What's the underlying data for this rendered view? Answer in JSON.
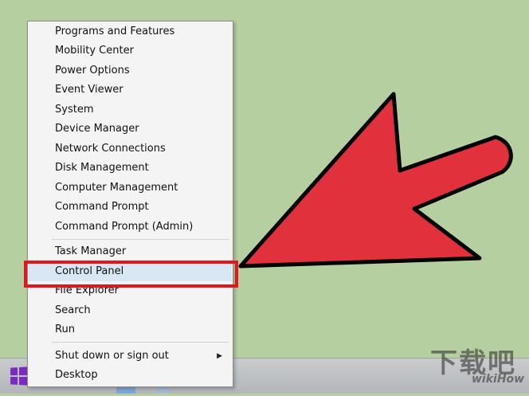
{
  "menu": {
    "items": [
      {
        "label": "Programs and Features"
      },
      {
        "label": "Mobility Center"
      },
      {
        "label": "Power Options"
      },
      {
        "label": "Event Viewer"
      },
      {
        "label": "System"
      },
      {
        "label": "Device Manager"
      },
      {
        "label": "Network Connections"
      },
      {
        "label": "Disk Management"
      },
      {
        "label": "Computer Management"
      },
      {
        "label": "Command Prompt"
      },
      {
        "label": "Command Prompt (Admin)"
      },
      {
        "label": "Task Manager"
      },
      {
        "label": "Control Panel"
      },
      {
        "label": "File Explorer"
      },
      {
        "label": "Search"
      },
      {
        "label": "Run"
      },
      {
        "label": "Shut down or sign out"
      },
      {
        "label": "Desktop"
      }
    ],
    "highlighted_item": "Control Panel"
  },
  "colors": {
    "desktop_background": "#b6cfa0",
    "pointer_arrow": "#e0313d",
    "highlight_box": "#e3161d",
    "start_logo": "#7a2bc2"
  },
  "watermark": {
    "big_text": "下载吧",
    "small_text": "wikiHow"
  }
}
